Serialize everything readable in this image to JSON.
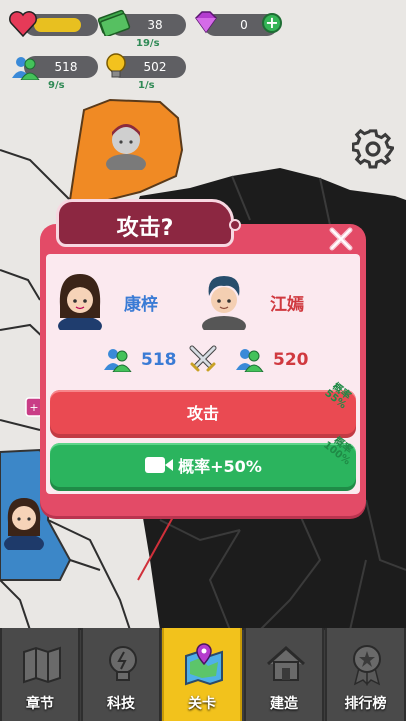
{
  "hud": {
    "health_fill": 0.78,
    "cash_value": "38",
    "cash_rate": "19/s",
    "gem_value": "0",
    "people_value": "518",
    "people_rate": "9/s",
    "idea_value": "502",
    "idea_rate": "1/s"
  },
  "dialog": {
    "title": "攻击?",
    "player_name": "康梓",
    "enemy_name": "江嫣",
    "player_power": "518",
    "enemy_power": "520",
    "attack_label": "攻击",
    "attack_chance_label": "概率",
    "attack_chance_value": "55%",
    "video_label": "概率+50%",
    "video_chance_label": "概率",
    "video_chance_value": "100%"
  },
  "nav": {
    "items": [
      {
        "label": "章节",
        "icon": "map-icon"
      },
      {
        "label": "科技",
        "icon": "lightbulb-icon"
      },
      {
        "label": "关卡",
        "icon": "level-map-icon"
      },
      {
        "label": "建造",
        "icon": "house-icon"
      },
      {
        "label": "排行榜",
        "icon": "medal-icon"
      }
    ],
    "active_index": 2
  },
  "colors": {
    "dialog_red": "#e34b67",
    "title_maroon": "#8c2741",
    "attack_button": "#ea4a52",
    "video_button": "#2bb45e",
    "player_name": "#3a7bd5",
    "enemy_name": "#d0393f",
    "nav_active": "#f2c21c"
  }
}
